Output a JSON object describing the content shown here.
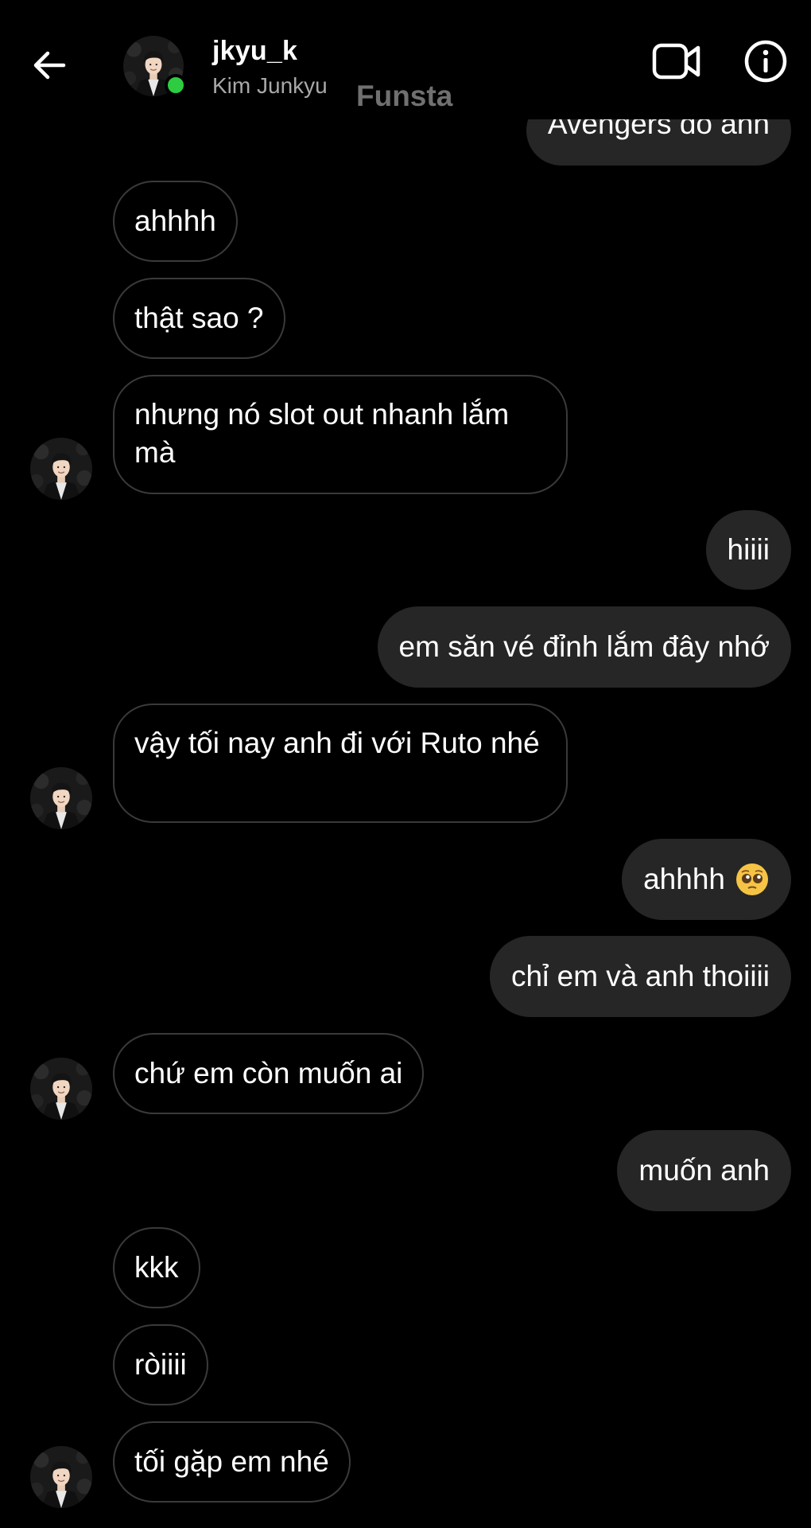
{
  "header": {
    "username": "jkyu_k",
    "full_name": "Kim Junkyu",
    "watermark": "Funsta",
    "back_icon": "arrow-left-icon",
    "video_icon": "video-camera-icon",
    "info_icon": "info-icon"
  },
  "colors": {
    "background": "#000000",
    "sent_bubble": "#262626",
    "received_border": "#3a3a3a",
    "online": "#2ecc40",
    "subtext": "#a8a8a8"
  },
  "messages": [
    {
      "side": "sent",
      "text": "Avengers đó anh"
    },
    {
      "side": "received",
      "text": "ahhhh"
    },
    {
      "side": "received",
      "text": "thật sao ?"
    },
    {
      "side": "received",
      "text": "nhưng nó slot out nhanh lắm mà",
      "avatar": true
    },
    {
      "side": "sent",
      "text": "hiiii"
    },
    {
      "side": "sent",
      "text": "em săn vé đỉnh lắm đây nhớ"
    },
    {
      "side": "received",
      "text": "vậy tối nay anh đi với Ruto nhé",
      "avatar": true
    },
    {
      "side": "sent",
      "text": "ahhhh",
      "emoji": "pleading-face-emoji"
    },
    {
      "side": "sent",
      "text": "chỉ em và anh thoiiii"
    },
    {
      "side": "received",
      "text": "chứ em còn muốn ai",
      "avatar": true
    },
    {
      "side": "sent",
      "text": "muốn anh"
    },
    {
      "side": "received",
      "text": "kkk"
    },
    {
      "side": "received",
      "text": "ròiiii"
    },
    {
      "side": "received",
      "text": "tối gặp em nhé",
      "avatar": true
    }
  ]
}
